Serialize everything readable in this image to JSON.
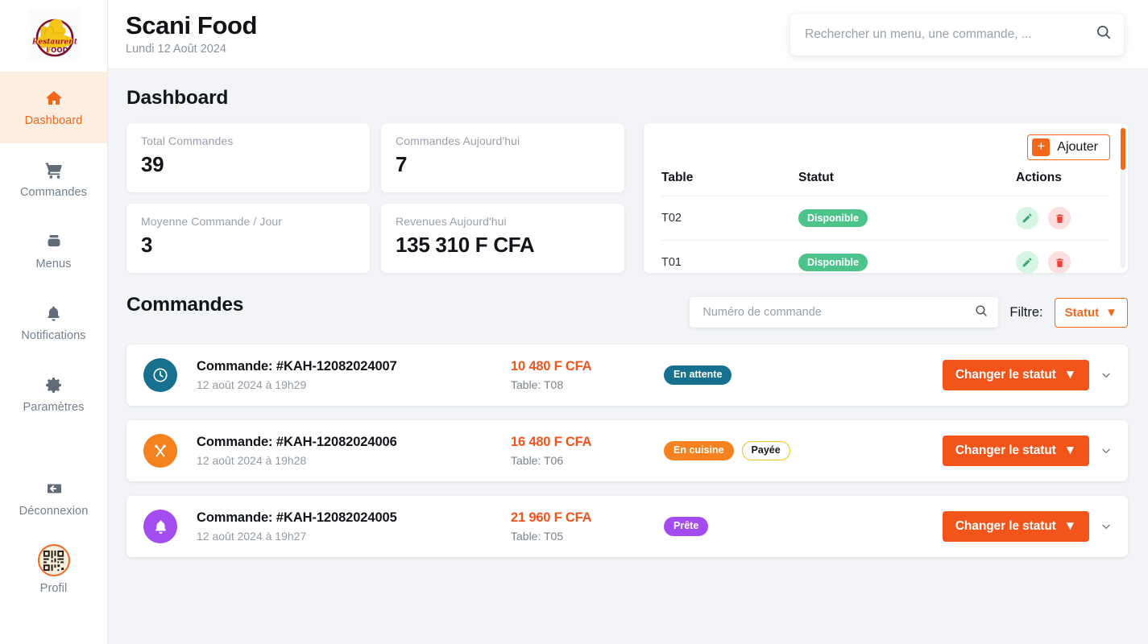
{
  "sidebar": {
    "logo": {
      "name": "restaurant-food-logo",
      "word_top": "Restaurent",
      "word_bottom": "FOOD"
    },
    "items": [
      {
        "label": "Dashboard",
        "icon": "home-icon",
        "active": true
      },
      {
        "label": "Commandes",
        "icon": "shopping-cart-icon",
        "active": false
      },
      {
        "label": "Menus",
        "icon": "menu-book-icon",
        "active": false
      },
      {
        "label": "Notifications",
        "icon": "bell-icon",
        "active": false
      },
      {
        "label": "Paramètres",
        "icon": "gear-icon",
        "active": false
      },
      {
        "label": "Déconnexion",
        "icon": "logout-arrow-icon",
        "active": false
      },
      {
        "label": "Profil",
        "icon": "qr-avatar-icon",
        "active": false
      }
    ]
  },
  "header": {
    "title": "Scani Food",
    "date": "Lundi 12 Août 2024",
    "search_placeholder": "Rechercher un menu, une commande, ...",
    "search_value": "",
    "search_icon": "search-icon"
  },
  "dashboard": {
    "title": "Dashboard",
    "stats": [
      {
        "label": "Total Commandes",
        "value": "39"
      },
      {
        "label": "Commandes Aujourd'hui",
        "value": "7"
      },
      {
        "label": "Moyenne Commande / Jour",
        "value": "3"
      },
      {
        "label": "Revenues Aujourd'hui",
        "value": "135 310 F CFA"
      }
    ]
  },
  "tables_panel": {
    "add_label": "Ajouter",
    "add_icon": "plus-icon",
    "columns": [
      "Table",
      "Statut",
      "Actions"
    ],
    "rows": [
      {
        "table": "T02",
        "statut": "Disponible"
      },
      {
        "table": "T01",
        "statut": "Disponible"
      }
    ],
    "row_actions": {
      "edit_icon": "pencil-icon",
      "delete_icon": "trash-icon"
    },
    "scroll_thumb_color": "#f2671a"
  },
  "orders": {
    "title": "Commandes",
    "search_placeholder": "Numéro de commande",
    "search_value": "",
    "search_icon": "search-icon",
    "filter_label": "Filtre:",
    "filter_value": "Statut",
    "filter_caret": "▼",
    "status_button_label": "Changer le statut",
    "status_button_caret": "▼",
    "expand_icon": "chevron-down-icon",
    "items": [
      {
        "icon": "clock-icon",
        "icon_color": "#17708d",
        "title": "Commande: #KAH-12082024007",
        "date": "12 août 2024 à 19h29",
        "price": "10 480 F CFA",
        "table": "Table: T08",
        "badges": [
          {
            "text": "En attente",
            "color": "#17708d",
            "style": "solid"
          }
        ]
      },
      {
        "icon": "utensils-icon",
        "icon_color": "#f5821f",
        "title": "Commande: #KAH-12082024006",
        "date": "12 août 2024 à 19h28",
        "price": "16 480 F CFA",
        "table": "Table: T06",
        "badges": [
          {
            "text": "En cuisine",
            "color": "#f5821f",
            "style": "solid"
          },
          {
            "text": "Payée",
            "color": "#f0c419",
            "style": "outline"
          }
        ]
      },
      {
        "icon": "bell-icon",
        "icon_color": "#a34df0",
        "title": "Commande: #KAH-12082024005",
        "date": "12 août 2024 à 19h27",
        "price": "21 960 F CFA",
        "table": "Table: T05",
        "badges": [
          {
            "text": "Prête",
            "color": "#a34df0",
            "style": "solid"
          }
        ]
      }
    ]
  },
  "colors": {
    "accent_orange": "#f2671a",
    "price_orange": "#f2541a",
    "available_green": "#4cc38a",
    "page_bg": "#f2f4f7"
  }
}
